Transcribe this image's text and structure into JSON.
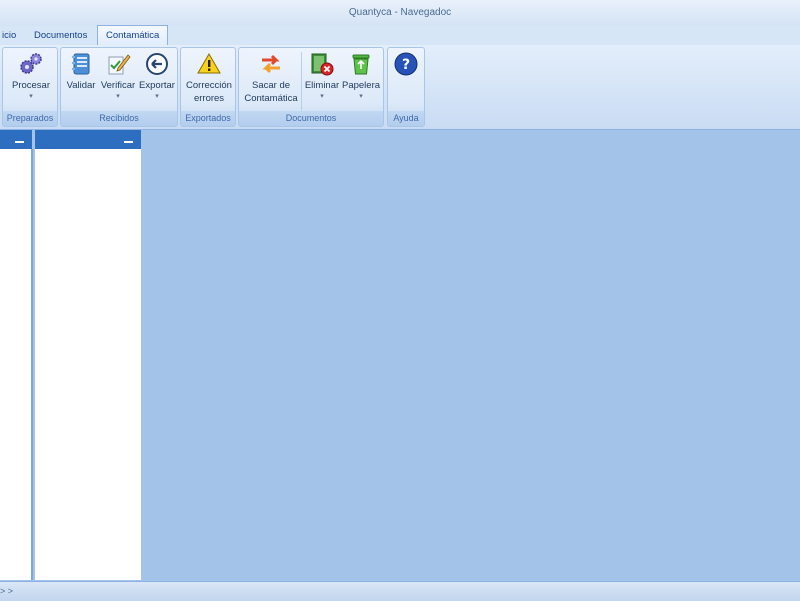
{
  "window": {
    "title": "Quantyca - Navegadoc"
  },
  "tabs": [
    {
      "label": "icio"
    },
    {
      "label": "Documentos"
    },
    {
      "label": "Contamática"
    }
  ],
  "ribbon": {
    "groups": {
      "preparados": "Preparados",
      "recibidos": "Recibidos",
      "exportados": "Exportados",
      "documentos": "Documentos",
      "ayuda": "Ayuda"
    },
    "buttons": {
      "procesar": "Procesar",
      "validar": "Validar",
      "verificar": "Verificar",
      "exportar": "Exportar",
      "correccion_1": "Corrección",
      "correccion_2": "errores",
      "sacar_1": "Sacar de",
      "sacar_2": "Contamática",
      "eliminar": "Eliminar",
      "papelera": "Papelera"
    },
    "dropdown_glyph": "▾",
    "icons": {
      "procesar": "gears-icon",
      "validar": "notebook-icon",
      "verificar": "pencil-check-icon",
      "exportar": "arrow-left-circle-icon",
      "correccion": "warning-icon",
      "sacar": "swap-arrows-icon",
      "eliminar": "delete-red-x-icon",
      "papelera": "recycle-bin-icon",
      "ayuda": "help-icon"
    }
  },
  "statusbar": {
    "text": "> >"
  },
  "colors": {
    "workspace": "#a4c3e8",
    "pane_header": "#2e6ec0",
    "ribbon": "#dce9f8"
  }
}
